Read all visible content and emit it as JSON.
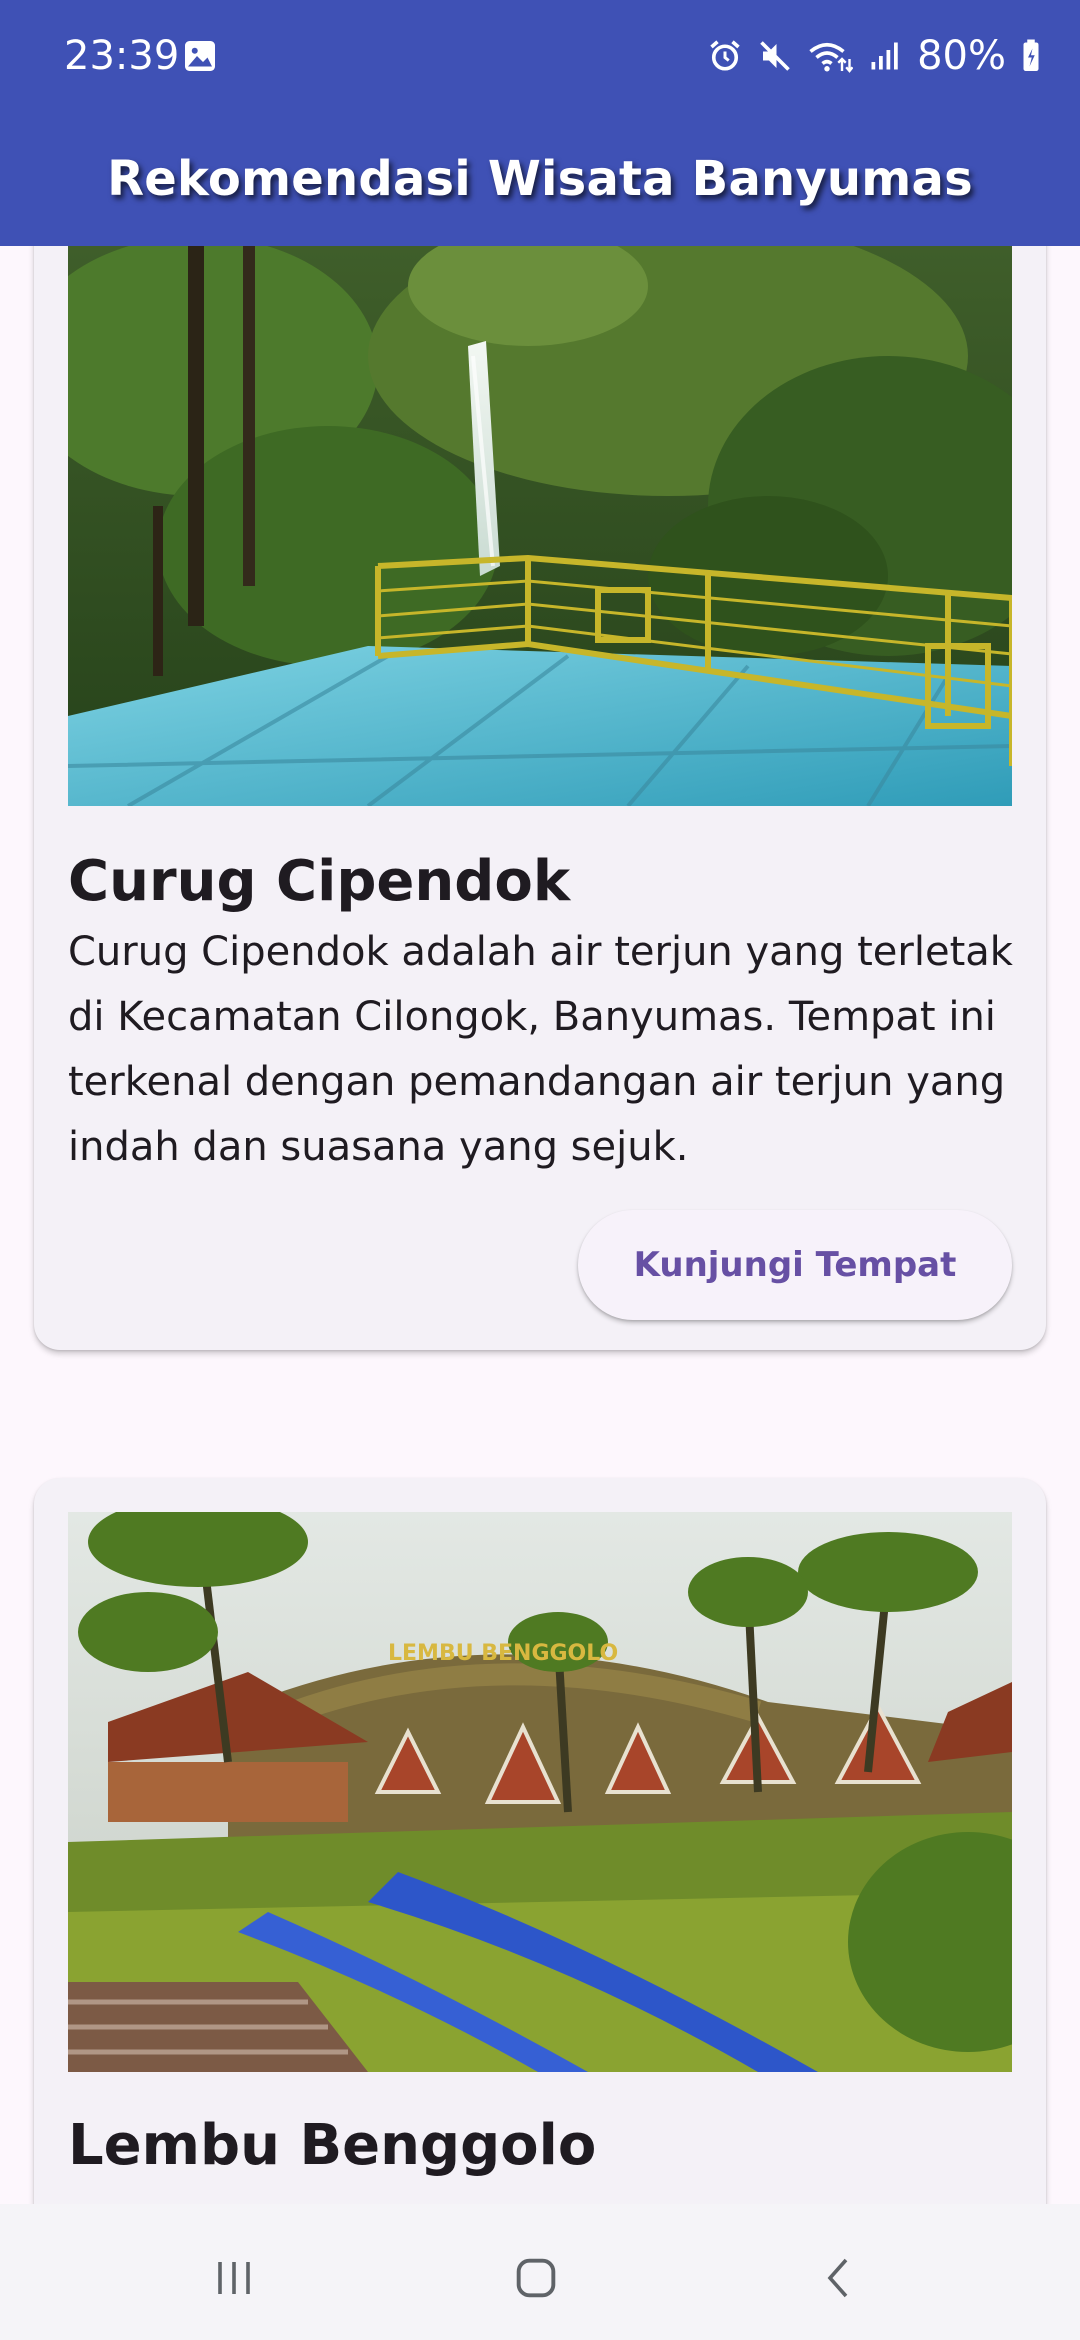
{
  "status_bar": {
    "time": "23:39",
    "battery": "80%",
    "icons": [
      "gallery-icon",
      "alarm-icon",
      "mute-icon",
      "wifi-icon",
      "signal-icon",
      "battery-icon"
    ]
  },
  "app_bar": {
    "title": "Rekomendasi Wisata Banyumas",
    "color": "#3f51b5"
  },
  "cards": [
    {
      "title": "Curug Cipendok",
      "description": "Curug Cipendok adalah air terjun yang terletak di Kecamatan Cilongok, Banyumas. Tempat ini terkenal dengan pemandangan air terjun yang indah dan suasana yang sejuk.",
      "button_label": "Kunjungi Tempat"
    },
    {
      "title": "Lembu Benggolo"
    }
  ],
  "colors": {
    "accent": "#6750a4",
    "card_background": "#f4f1f7",
    "page_background": "#fdf7fd"
  },
  "nav_bar": {
    "buttons": [
      "recents-icon",
      "home-icon",
      "back-icon"
    ]
  }
}
